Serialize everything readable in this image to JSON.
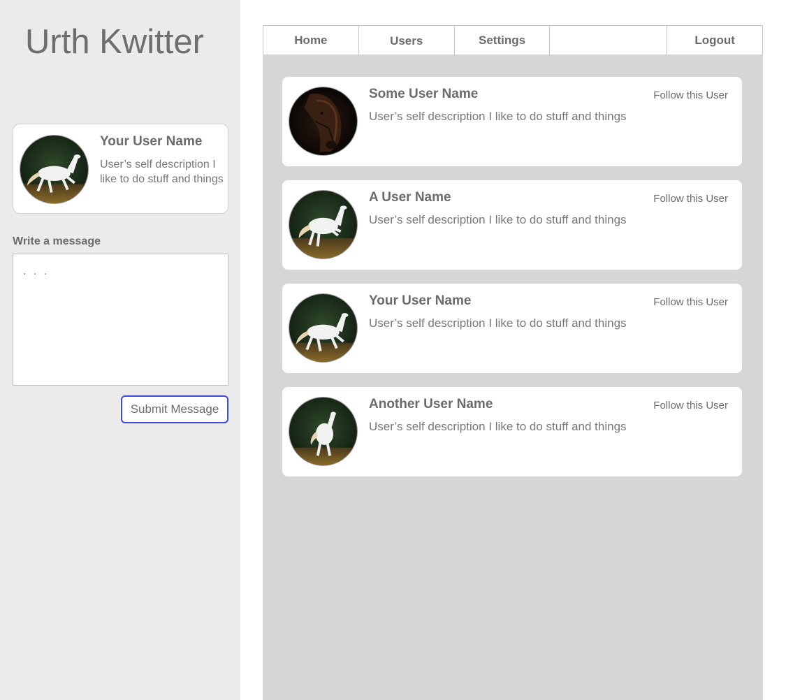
{
  "app": {
    "title": "Urth Kwitter"
  },
  "profile": {
    "name": "Your User Name",
    "description": "User’s self description I like to do stuff and things",
    "avatar_icon": "white-horse-photo"
  },
  "compose": {
    "label": "Write a message",
    "placeholder": ". . .",
    "submit_label": "Submit Message"
  },
  "nav": {
    "tabs": [
      {
        "label": "Home",
        "active": false
      },
      {
        "label": "Users",
        "active": true
      },
      {
        "label": "Settings",
        "active": false
      },
      {
        "label": "",
        "active": false
      },
      {
        "label": "Logout",
        "active": false
      }
    ],
    "accent_color": "#3f4bd6"
  },
  "users": [
    {
      "name": "Some User Name",
      "description": "User’s self description I like to do stuff and things",
      "follow_label": "Follow this User",
      "avatar_icon": "brown-horse-photo"
    },
    {
      "name": "A User Name",
      "description": "User’s self description I like to do stuff and things",
      "follow_label": "Follow this User",
      "avatar_icon": "white-horse-photo"
    },
    {
      "name": "Your User Name",
      "description": "User’s self description I like to do stuff and things",
      "follow_label": "Follow this User",
      "avatar_icon": "white-horse-photo"
    },
    {
      "name": "Another User Name",
      "description": "User’s self description I like to do stuff and things",
      "follow_label": "Follow this User",
      "avatar_icon": "white-horse-photo"
    }
  ]
}
